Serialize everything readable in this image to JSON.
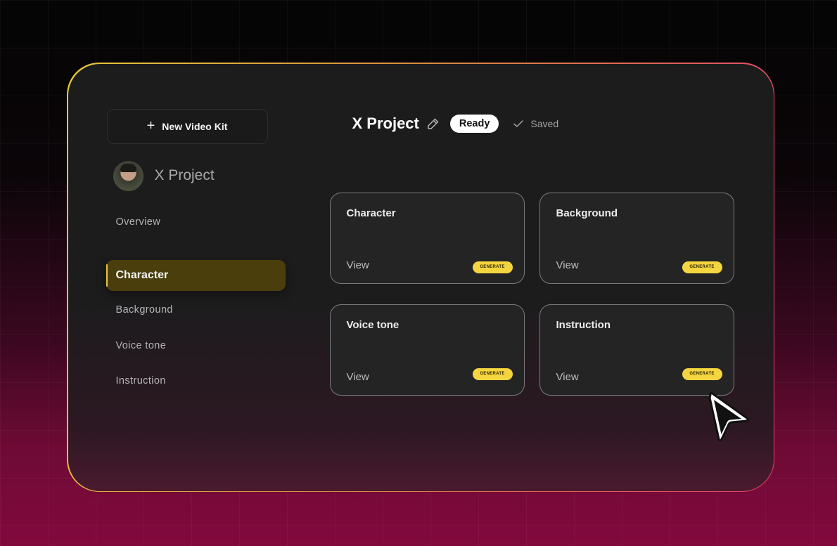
{
  "sidebar": {
    "new_kit_label": "New Video Kit",
    "new_kit_icon": "plus-icon",
    "project_name": "X Project",
    "nav": {
      "overview": "Overview",
      "character": "Character",
      "background": "Background",
      "voice_tone": "Voice tone",
      "instruction": "Instruction"
    },
    "active_item": "Character"
  },
  "header": {
    "title": "X Project",
    "edit_icon": "pencil-icon",
    "status_badge": "Ready",
    "save_icon": "check-icon",
    "save_status": "Saved"
  },
  "cards": [
    {
      "title": "Character",
      "view_label": "View",
      "generate_label": "GENERATE"
    },
    {
      "title": "Background",
      "view_label": "View",
      "generate_label": "GENERATE"
    },
    {
      "title": "Voice tone",
      "view_label": "View",
      "generate_label": "GENERATE"
    },
    {
      "title": "Instruction",
      "view_label": "View",
      "generate_label": "GENERATE"
    }
  ],
  "colors": {
    "accent": "#f5d53f",
    "active_nav_bg": "#4a3f0c",
    "panel_bg": "#1c1c1d",
    "border_gradient_start": "#e4c83a",
    "border_gradient_end": "#e2426e",
    "page_bottom": "#82093d"
  }
}
